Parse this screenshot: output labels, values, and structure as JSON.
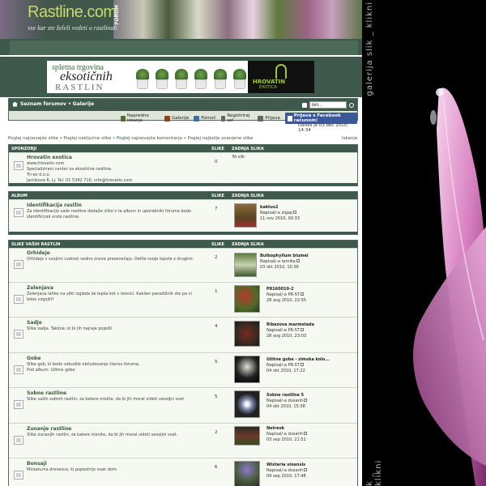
{
  "header": {
    "logo": "Rastline.com",
    "logo_badge": "FORUM",
    "tagline": "vse kar ste želeli vedeti o rastlinah"
  },
  "banner": {
    "line1": "spletna trgovina",
    "line2": "eksotičnih",
    "line3": "RASTLIN",
    "brand": "HROVATIN",
    "brand_sub": "EXOTICA"
  },
  "side": {
    "text_top": "galerija slik _ klikni",
    "text_bottom": "k _ klikni"
  },
  "nav": {
    "breadcrumb": "Seznam forumov • Galerije",
    "search_value": "Išči...",
    "links": [
      {
        "label": "Napredno iskanje",
        "color": "#556b2f"
      },
      {
        "label": "Galerije",
        "color": "#8b4513"
      },
      {
        "label": "Pomoč",
        "color": "#3a6ea5"
      },
      {
        "label": "Registriraj se!",
        "color": "#666666"
      },
      {
        "label": "Prijava",
        "color": "#666666"
      }
    ],
    "facebook": "Prijava s Facebook računom!"
  },
  "date_line": "Danes je 03 dec 2010, 14:34",
  "view_links": "Poglej najnovejše slike • Poglej naključne slike • Poglej najnovejše komentarje • Poglej najbolje ocenjene slike",
  "view_links_right": "Iskanje",
  "sections": [
    {
      "heading": "SPONZORJI",
      "col_images": "SLIKE",
      "col_last": "ZADNJA SLIKA",
      "rows": [
        {
          "title": "Hrovatin exotica",
          "desc": [
            "www.hrovatin.com",
            "Specializirani center za eksotične rastline.",
            "Tri-ex d.o.o.",
            "Jarnikova 6, Lj. Tel. 01 5342 710, info@hrovatin.com"
          ],
          "count": "0",
          "last": [
            "Ni slik"
          ]
        }
      ]
    },
    {
      "heading": "ALBUM",
      "col_images": "SLIKE",
      "col_last": "ZADNJA SLIKA",
      "rows": [
        {
          "title": "Identifikacija rastlin",
          "desc": [
            "Za identifikacijo vaše rastline dodajte sliko v ta album in uporabniki foruma bodo",
            "identificirali vrsto rastline."
          ],
          "count": "7",
          "last": [
            "kaktus2",
            "Napisal/-a zigap",
            "11 nov 2010, 00:33"
          ]
        }
      ]
    },
    {
      "heading": "SLIKE VAŠIH RASTLIN",
      "col_images": "SLIKE",
      "col_last": "ZADNJA SLIKA",
      "rows": [
        {
          "title": "Orhideje",
          "desc": [
            "Orhideje s svojimi cvetovi vedno znova presenečajo. Delite svoje lepote z drugimi."
          ],
          "count": "2",
          "last": [
            "Bulbophyllum blumei",
            "Napisal/-a tamika",
            "03 okt 2010, 10:36"
          ]
        },
        {
          "title": "Zelenjava",
          "desc": [
            "Zelenjava lahko na sliki izgleda še lepša kot v resnici. Kakšen paradižnik ste pa vi",
            "letos vzgojili?"
          ],
          "count": "1",
          "last": [
            "P8160010-2",
            "Napisal/-a PR-ST",
            "28 avg 2010, 22:55"
          ]
        },
        {
          "title": "Sadje",
          "desc": [
            "Slike sadja. Takšne, ki bi jih najraje pojedli."
          ],
          "count": "4",
          "last": [
            "Ribezova marmelada",
            "Napisal/-a PR-ST",
            "28 avg 2010, 23:03"
          ]
        },
        {
          "title": "Gobe",
          "desc": [
            "Slike gob, ki bodo vzbudile občudovanje članov foruma.",
            "Pod album: Užitne gobe"
          ],
          "count": "5",
          "last": [
            "Užitne gobe - zimska kolo...",
            "Napisal/-a PR-ST",
            "04 okt 2010, 17:22"
          ]
        },
        {
          "title": "Sobne rastline",
          "desc": [
            "Slike vaših sobnih rastlin, za katere mislite, da bi jih moral videti vesoljni svet"
          ],
          "count": "5",
          "last": [
            "Sobne rastline 5",
            "Napisal/-a dusanh",
            "04 okt 2010, 15:38"
          ]
        },
        {
          "title": "Zunanje rastline",
          "desc": [
            "Slike zunanjih rastlin, za katere menite, da bi jih moral videti vesoljni svet."
          ],
          "count": "2",
          "last": [
            "Netresk",
            "Napisal/-a dusanh",
            "03 sep 2010, 21:51"
          ]
        },
        {
          "title": "Bonsaji",
          "desc": [
            "Miniaturna drevesca, ki popestrijo vsak dom."
          ],
          "count": "6",
          "last": [
            "Wisteria sinensis",
            "Napisal/-a dusanh",
            "09 sep 2010, 17:48"
          ]
        }
      ]
    }
  ]
}
